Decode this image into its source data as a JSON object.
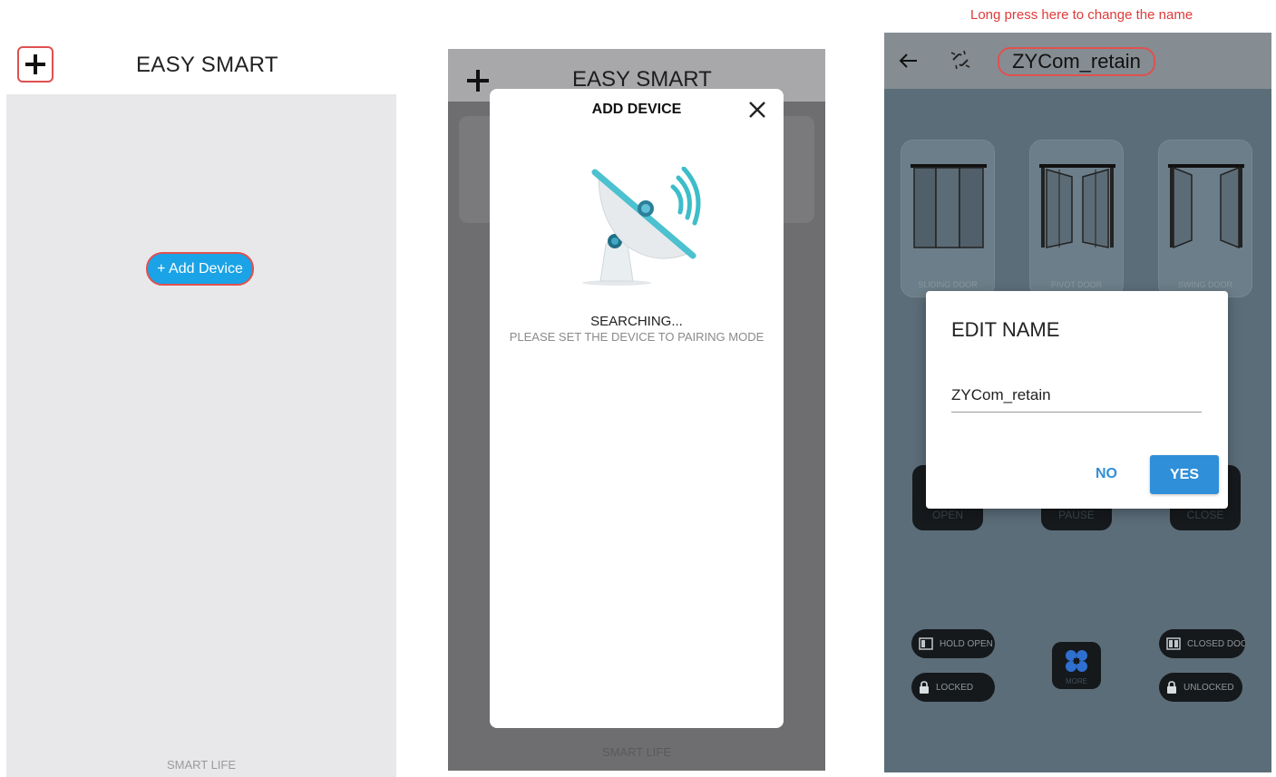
{
  "screen1": {
    "title": "EASY SMART",
    "add_device_label": "+ Add Device",
    "footer": "SMART LIFE"
  },
  "screen2": {
    "title": "EASY SMART",
    "footer": "SMART LIFE",
    "modal": {
      "title": "ADD DEVICE",
      "status": "SEARCHING...",
      "hint": "PLEASE SET THE DEVICE TO PAIRING MODE"
    }
  },
  "screen3": {
    "annotation": "Long press here to change the name",
    "device_name": "ZYCom_retain",
    "door_types": [
      {
        "label": "SLIDING DOOR"
      },
      {
        "label": "PIVOT DOOR"
      },
      {
        "label": "SWING DOOR"
      }
    ],
    "controls": [
      {
        "label": "OPEN"
      },
      {
        "label": "PAUSE"
      },
      {
        "label": "CLOSE"
      }
    ],
    "modes": {
      "hold_open": "HOLD OPEN",
      "locked": "LOCKED",
      "closed_door": "CLOSED DOOR",
      "unlocked": "UNLOCKED",
      "more": "MORE"
    },
    "dialog": {
      "title": "EDIT NAME",
      "input_value": "ZYCom_retain",
      "no_label": "NO",
      "yes_label": "YES"
    }
  },
  "colors": {
    "accent_blue": "#1aa3e6",
    "dialog_blue": "#2f8fd8",
    "highlight_red": "#e05050"
  },
  "icons": {
    "add": "plus-icon",
    "close": "close-icon",
    "back": "arrow-left-icon",
    "unlink": "unlink-icon",
    "satellite": "satellite-dish-icon",
    "lock": "lock-icon",
    "more": "clover-icon"
  }
}
